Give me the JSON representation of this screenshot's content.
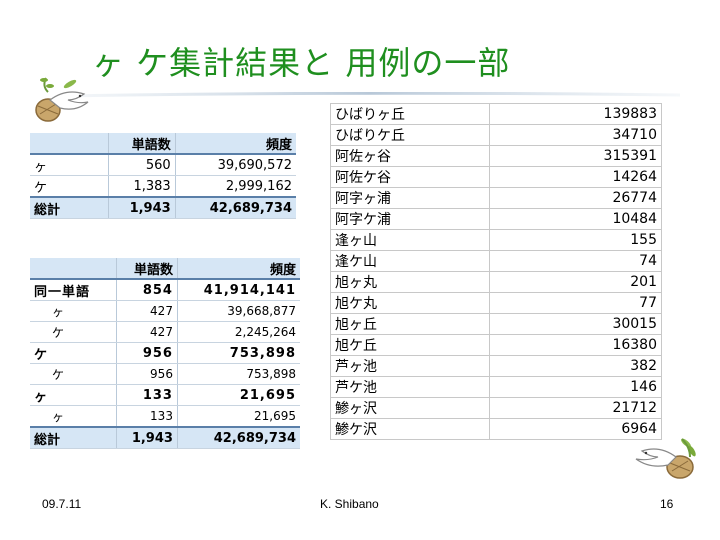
{
  "slide": {
    "title": "ヶ ケ集計結果と 用例の一部",
    "footer": {
      "date": "09.7.11",
      "author": "K. Shibano",
      "page": "16"
    }
  },
  "table1": {
    "headers": [
      "",
      "単語数",
      "頻度"
    ],
    "rows": [
      {
        "label": "ヶ",
        "count": "560",
        "freq": "39,690,572"
      },
      {
        "label": "ケ",
        "count": "1,383",
        "freq": "2,999,162"
      }
    ],
    "total": {
      "label": "総計",
      "count": "1,943",
      "freq": "42,689,734"
    }
  },
  "table2": {
    "headers": [
      "",
      "単語数",
      "頻度"
    ],
    "rows": [
      {
        "label": "同一単語",
        "count": "854",
        "freq": "41,914,141",
        "bold": true
      },
      {
        "label": "ヶ",
        "count": "427",
        "freq": "39,668,877",
        "bold": false
      },
      {
        "label": "ケ",
        "count": "427",
        "freq": "2,245,264",
        "bold": false
      },
      {
        "label": "ケ",
        "count": "956",
        "freq": "753,898",
        "bold": true
      },
      {
        "label": "ケ",
        "count": "956",
        "freq": "753,898",
        "bold": false
      },
      {
        "label": "ヶ",
        "count": "133",
        "freq": "21,695",
        "bold": true
      },
      {
        "label": "ヶ",
        "count": "133",
        "freq": "21,695",
        "bold": false
      }
    ],
    "total": {
      "label": "総計",
      "count": "1,943",
      "freq": "42,689,734"
    }
  },
  "table3": {
    "rows": [
      {
        "name": "ひばりヶ丘",
        "value": "139883"
      },
      {
        "name": "ひばりケ丘",
        "value": "34710"
      },
      {
        "name": "阿佐ヶ谷",
        "value": "315391"
      },
      {
        "name": "阿佐ケ谷",
        "value": "14264"
      },
      {
        "name": "阿字ヶ浦",
        "value": "26774"
      },
      {
        "name": "阿字ケ浦",
        "value": "10484"
      },
      {
        "name": "逢ヶ山",
        "value": "155"
      },
      {
        "name": "逢ケ山",
        "value": "74"
      },
      {
        "name": "旭ヶ丸",
        "value": "201"
      },
      {
        "name": "旭ケ丸",
        "value": "77"
      },
      {
        "name": "旭ヶ丘",
        "value": "30015"
      },
      {
        "name": "旭ケ丘",
        "value": "16380"
      },
      {
        "name": "芦ヶ池",
        "value": "382"
      },
      {
        "name": "芦ケ池",
        "value": "146"
      },
      {
        "name": "鯵ヶ沢",
        "value": "21712"
      },
      {
        "name": "鯵ケ沢",
        "value": "6964"
      }
    ]
  },
  "colors": {
    "title": "#1f8f1f",
    "header_bg": "#d6e6f5",
    "accent_line": "#5a7fa8"
  },
  "icons": [
    "dove-with-basket-icon"
  ]
}
